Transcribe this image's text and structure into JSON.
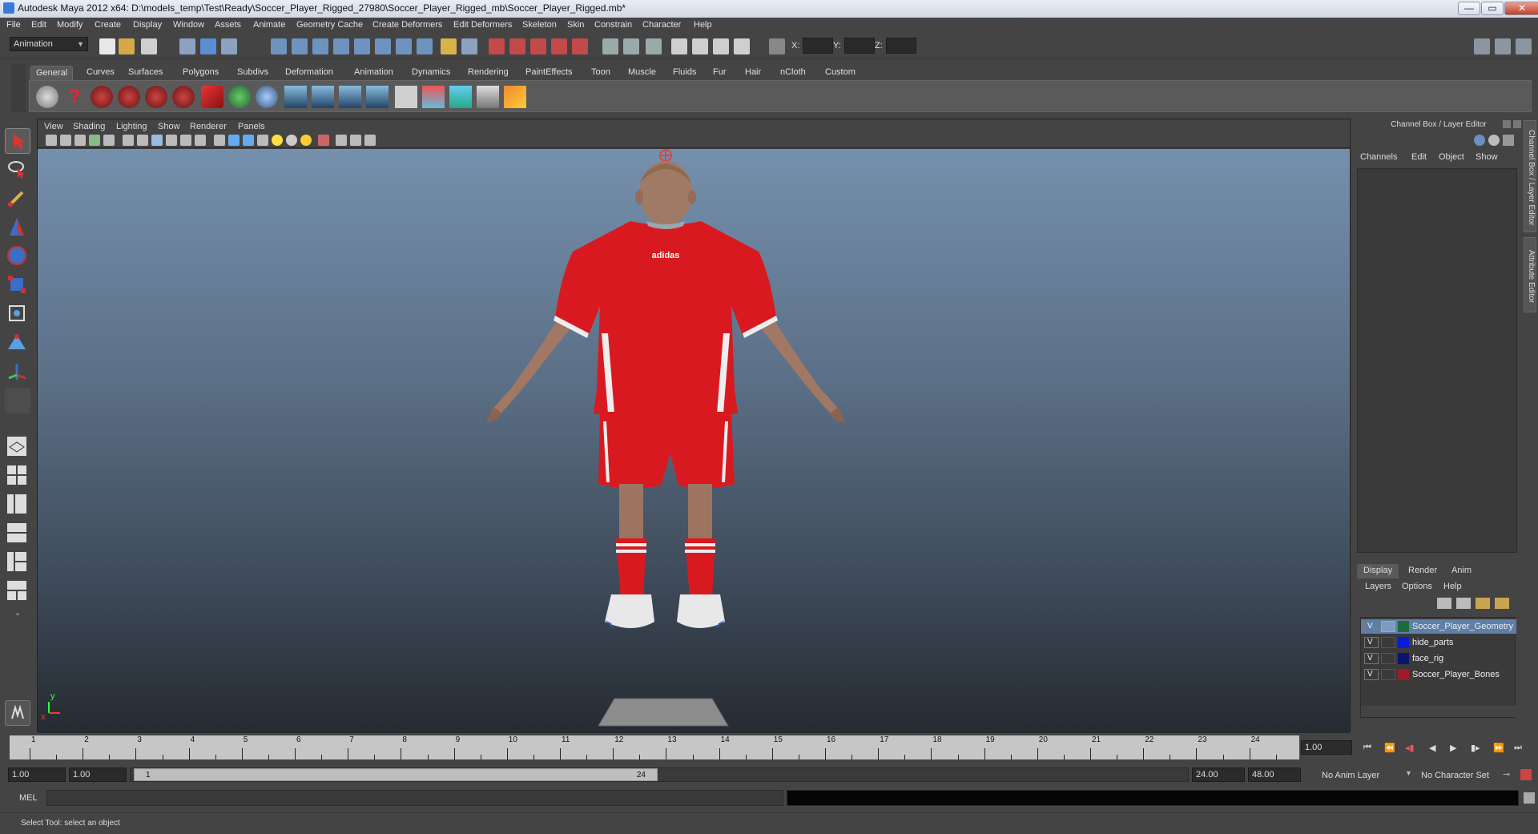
{
  "window": {
    "title": "Autodesk Maya 2012 x64: D:\\models_temp\\Test\\Ready\\Soccer_Player_Rigged_27980\\Soccer_Player_Rigged_mb\\Soccer_Player_Rigged.mb*",
    "minimize": "—",
    "maximize": "▭",
    "close": "✕"
  },
  "menubar": [
    "File",
    "Edit",
    "Modify",
    "Create",
    "Display",
    "Window",
    "Assets",
    "Animate",
    "Geometry Cache",
    "Create Deformers",
    "Edit Deformers",
    "Skeleton",
    "Skin",
    "Constrain",
    "Character",
    "Help"
  ],
  "statusline": {
    "menuset": "Animation",
    "x_label": "X:",
    "y_label": "Y:",
    "z_label": "Z:"
  },
  "shelf": {
    "tabs": [
      "General",
      "Curves",
      "Surfaces",
      "Polygons",
      "Subdivs",
      "Deformation",
      "Animation",
      "Dynamics",
      "Rendering",
      "PaintEffects",
      "Toon",
      "Muscle",
      "Fluids",
      "Fur",
      "Hair",
      "nCloth",
      "Custom"
    ],
    "active_tab": "General"
  },
  "viewport": {
    "menu": [
      "View",
      "Shading",
      "Lighting",
      "Show",
      "Renderer",
      "Panels"
    ],
    "axis_y": "y",
    "axis_x": "x",
    "shirt_logo": "adidas"
  },
  "channelbox": {
    "title": "Channel Box / Layer Editor",
    "menu": [
      "Channels",
      "Edit",
      "Object",
      "Show"
    ],
    "side_tabs": [
      "Channel Box / Layer Editor",
      "Attribute Editor"
    ]
  },
  "layers": {
    "tabs": [
      "Display",
      "Render",
      "Anim"
    ],
    "active_tab": "Display",
    "menu": [
      "Layers",
      "Options",
      "Help"
    ],
    "items": [
      {
        "visible": "V",
        "name": "Soccer_Player_Geometry",
        "color": "#1e6a3a",
        "selected": true
      },
      {
        "visible": "V",
        "name": "hide_parts",
        "color": "#0a1ad8",
        "selected": false
      },
      {
        "visible": "V",
        "name": "face_rig",
        "color": "#0a1470",
        "selected": false
      },
      {
        "visible": "V",
        "name": "Soccer_Player_Bones",
        "color": "#a01a2a",
        "selected": false
      }
    ]
  },
  "timeslider": {
    "ticks": [
      "1",
      "2",
      "3",
      "4",
      "5",
      "6",
      "7",
      "8",
      "9",
      "10",
      "11",
      "12",
      "13",
      "14",
      "15",
      "16",
      "17",
      "18",
      "19",
      "20",
      "21",
      "22",
      "23",
      "24"
    ],
    "current_time": "1.00"
  },
  "range": {
    "start_time": "1.00",
    "playback_start": "1.00",
    "range_start_label": "1",
    "range_end_label": "24",
    "playback_end": "24.00",
    "end_time": "48.00",
    "anim_layer": "No Anim Layer",
    "character_set": "No Character Set"
  },
  "commandline": {
    "label": "MEL"
  },
  "helpline": {
    "text": "Select Tool: select an object"
  }
}
